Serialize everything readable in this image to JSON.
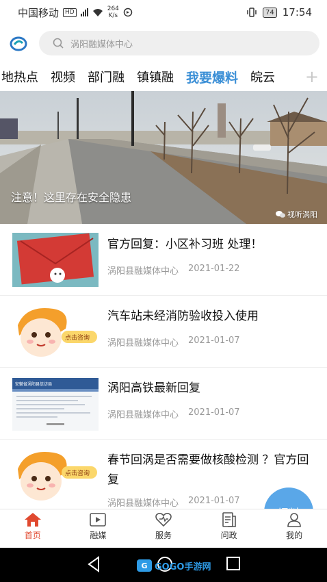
{
  "status_bar": {
    "carrier": "中国移动",
    "network_badge": "HD",
    "net_type": "4G",
    "speed_value": "264",
    "speed_unit": "K/s",
    "battery": "74",
    "time": "17:54"
  },
  "search": {
    "placeholder": "涡阳融媒体中心"
  },
  "tabs": [
    {
      "label": "地热点"
    },
    {
      "label": "视频"
    },
    {
      "label": "部门融"
    },
    {
      "label": "镇镇融"
    },
    {
      "label": "我要爆料",
      "active": true
    },
    {
      "label": "皖云"
    }
  ],
  "tabs_more": "+",
  "hero": {
    "caption": "注意！这里存在安全隐患",
    "source": "视听涡阳"
  },
  "news": [
    {
      "title": "官方回复：小区补习班 处理！",
      "source": "涡阳县融媒体中心",
      "date": "2021-01-22"
    },
    {
      "title": "汽车站未经消防验收投入使用",
      "source": "涡阳县融媒体中心",
      "date": "2021-01-07"
    },
    {
      "title": "涡阳高铁最新回复",
      "source": "涡阳县融媒体中心",
      "date": "2021-01-07"
    },
    {
      "title": "春节回涡是否需要做核酸检测 ？官方回复",
      "source": "涡阳县融媒体中心",
      "date": "2021-01-07"
    }
  ],
  "thumb_text": {
    "consult": "点击咨询",
    "doc_header": "安徽省涡阳县信访局"
  },
  "fab_label": "爆料",
  "bottom_nav": [
    {
      "label": "首页",
      "icon": "home-icon",
      "active": true
    },
    {
      "label": "融媒",
      "icon": "media-icon"
    },
    {
      "label": "服务",
      "icon": "service-icon"
    },
    {
      "label": "问政",
      "icon": "inquiry-icon"
    },
    {
      "label": "我的",
      "icon": "profile-icon"
    }
  ],
  "watermark": "GOGO手游网",
  "colors": {
    "accent": "#3b8fd6",
    "nav_active": "#e0492f",
    "fab": "#5aa7e8"
  }
}
